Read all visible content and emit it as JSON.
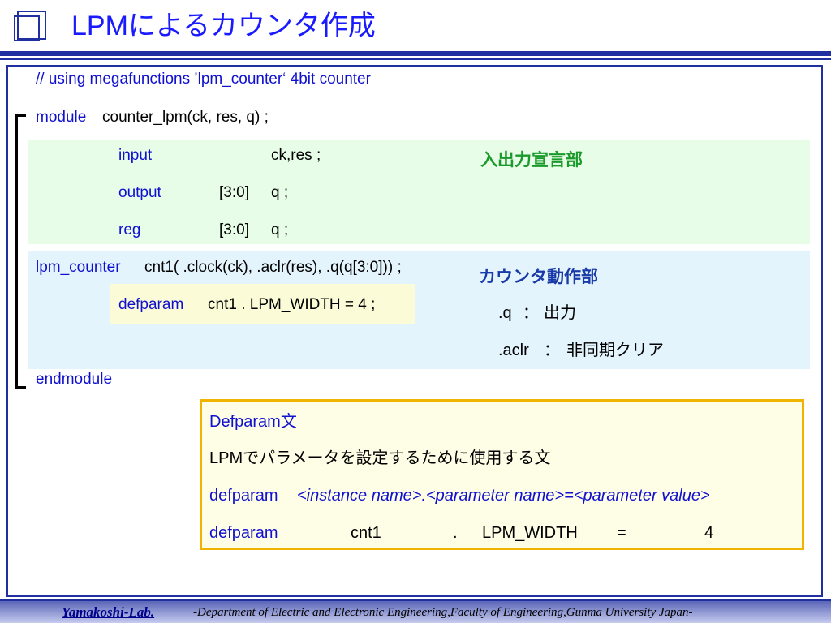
{
  "title": "LPMによるカウンタ作成",
  "code": {
    "comment": "// using megafunctions ’lpm_counter‘ 4bit counter",
    "module_kw": "module",
    "module_rest": "counter_lpm(ck, res, q) ;",
    "input_kw": "input",
    "input_rest": "ck,res ;",
    "output_kw": "output",
    "output_range": "[3:0]",
    "output_rest": "q ;",
    "reg_kw": "reg",
    "reg_range": "[3:0]",
    "reg_rest": "q ;",
    "lpm_kw": "lpm_counter",
    "lpm_rest": "cnt1( .clock(ck), .aclr(res), .q(q[3:0])) ;",
    "defparam_kw": "defparam",
    "defparam_rest": "cnt1 . LPM_WIDTH = 4 ;",
    "endmodule_kw": "endmodule"
  },
  "notes": {
    "io_decl": "入出力宣言部",
    "counter_op": "カウンタ動作部",
    "q_key": ".q",
    "q_sep": "：",
    "q_desc": "出力",
    "aclr_key": ".aclr",
    "aclr_sep": "：",
    "aclr_desc": "非同期クリア"
  },
  "definition": {
    "heading": "Defparam文",
    "description": "LPMでパラメータを設定するために使用する文",
    "syntax_kw": "defparam",
    "syntax_rest": "<instance name>.<parameter name>=<parameter value>",
    "example_kw": "defparam",
    "example_instance": "cnt1",
    "example_dot": ".",
    "example_param": "LPM_WIDTH",
    "example_eq": "=",
    "example_value": "4"
  },
  "footer": {
    "lab": "Yamakoshi-Lab.",
    "department": "-Department of Electric and Electronic Engineering,Faculty of Engineering,Gunma University Japan-"
  },
  "colors": {
    "keyword": "#1010d0",
    "title": "#1a1aff",
    "green_note": "#1a9a2a",
    "blue_note": "#1a3aa8",
    "accent_border": "#f0b400"
  }
}
